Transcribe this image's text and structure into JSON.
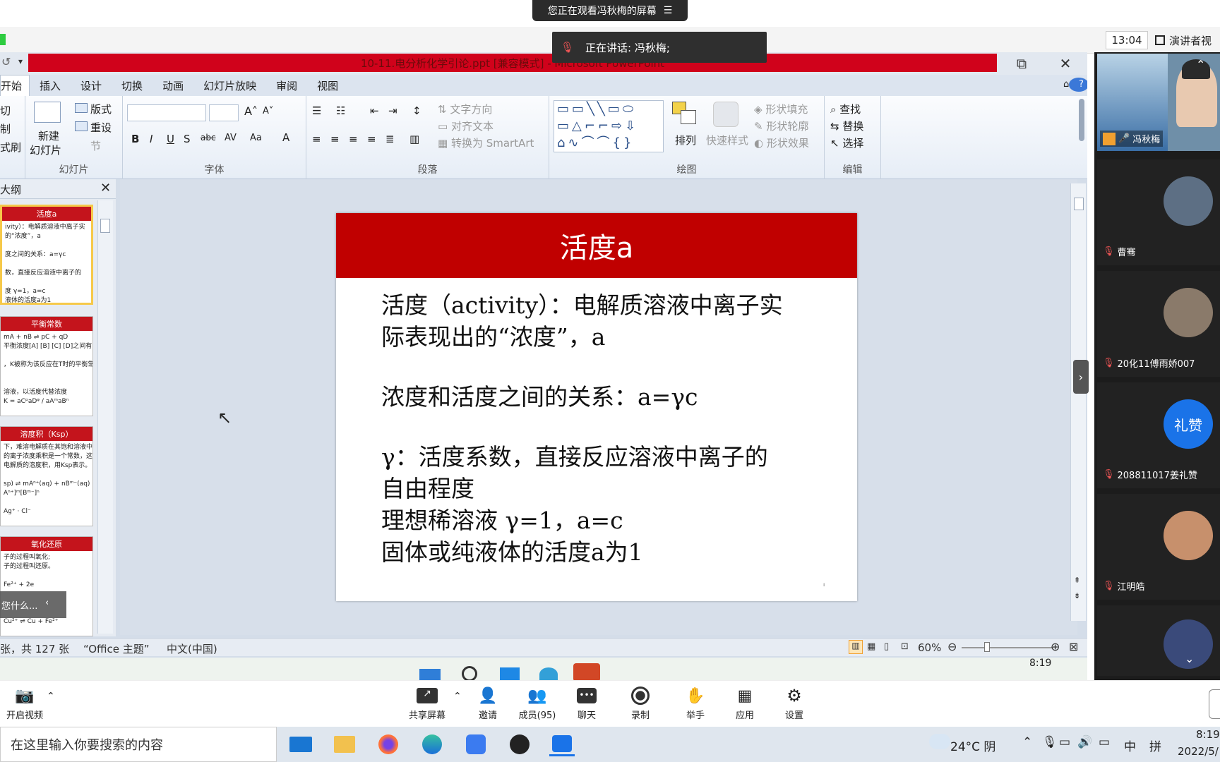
{
  "meeting": {
    "share_banner": "您正在观看冯秋梅的屏幕",
    "speaking": "正在讲话: 冯秋梅;",
    "clock": "13:04",
    "speaker_view": "演讲者视"
  },
  "ppt": {
    "title": "10-11.电分析化学引论.ppt [兼容模式] - Microsoft PowerPoint",
    "tabs": [
      "开始",
      "插入",
      "设计",
      "切换",
      "动画",
      "幻灯片放映",
      "审阅",
      "视图"
    ],
    "clipboard": {
      "cut": "切",
      "copy": "制",
      "format": "式刷"
    },
    "slides_group": {
      "new": "新建",
      "new2": "幻灯片",
      "layout": "版式",
      "reset": "重设",
      "section": "节",
      "label": "幻灯片"
    },
    "font_group": {
      "label": "字体"
    },
    "para_group": {
      "text_dir": "文字方向",
      "align_text": "对齐文本",
      "smartart": "转换为 SmartArt",
      "label": "段落"
    },
    "draw_group": {
      "arrange": "排列",
      "quick_styles": "快速样式",
      "fill": "形状填充",
      "outline": "形状轮廓",
      "effects": "形状效果",
      "label": "绘图"
    },
    "edit_group": {
      "find": "查找",
      "replace": "替换",
      "select": "选择",
      "label": "编辑"
    },
    "outline_tab": "大纲",
    "thumbs": [
      {
        "title": "活度a",
        "lines": [
          "ivity）：电解质溶液中离子实",
          "的“浓度”，a",
          "",
          "度之间的关系：a=γc",
          "",
          "数，直接反应溶液中离子的",
          "",
          "度 γ=1，a=c",
          "液体的活度a为1"
        ]
      },
      {
        "title": "平衡常数",
        "lines": [
          "mA + nB ⇌ pC + qD",
          "平衡浓度[A] [B] [C] [D]之间有",
          "",
          "，K被称为该反应在T时的平衡常",
          "",
          "",
          "溶液，以活度代替浓度",
          "K = aCᵖaDᵠ / aAᵐaBⁿ"
        ]
      },
      {
        "title": "溶度积（Ksp）",
        "lines": [
          "下，难溶电解质在其饱和溶液中",
          "的离子浓度乘积是一个常数，这个常数就",
          "电解质的溶度积，用Ksp表示。",
          "",
          "sp) ⇌ mAⁿ⁺(aq) + nBᵐ⁻(aq)",
          "Aⁿ⁺]ᵐ[Bᵐ⁻]ⁿ",
          "",
          "Ag⁺ · Cl⁻"
        ]
      },
      {
        "title": "氧化还原",
        "lines": [
          "子的过程叫氧化;",
          "子的过程叫还原。",
          "",
          "Fe²⁺ + 2e",
          "",
          "",
          "",
          "Cu²⁺ ⇌ Cu + Fe²⁺"
        ]
      }
    ],
    "thumb_overlay": "您什么...",
    "slide": {
      "title": "活度a",
      "lines": [
        "活度（activity）：电解质溶液中离子实",
        "际表现出的“浓度”，a",
        "",
        "浓度和活度之间的关系：a=γc",
        "",
        "γ：活度系数，直接反应溶液中离子的",
        "自由程度",
        "理想稀溶液 γ=1，a=c",
        "固体或纯液体的活度a为1"
      ]
    },
    "status": {
      "slide_count": "张，共 127 张",
      "theme": "“Office 主题”",
      "lang": "中文(中国)",
      "zoom": "60%"
    },
    "taskbar_time": "8:19"
  },
  "participants": [
    {
      "name": "冯秋梅",
      "avatar_text": "",
      "color": "#4a8de0"
    },
    {
      "name": "曹骞",
      "avatar_text": "",
      "color": "#6c7a8a"
    },
    {
      "name": "20化11傅雨娇007",
      "avatar_text": "",
      "color": "#8a7060"
    },
    {
      "name": "208811017姜礼赞",
      "avatar_text": "礼赞",
      "color": "#1a73e8"
    },
    {
      "name": "江明皓",
      "avatar_text": "",
      "color": "#c08a6a"
    }
  ],
  "toolbar": {
    "video": "开启视频",
    "share": "共享屏幕",
    "invite": "邀请",
    "members": "成员(95)",
    "chat": "聊天",
    "record": "录制",
    "raise": "举手",
    "apps": "应用",
    "settings": "设置"
  },
  "windows": {
    "search_placeholder": "在这里输入你要搜索的内容",
    "weather": "24°C 阴",
    "ime": "中",
    "ime2": "拼",
    "time": "8:19",
    "date": "2022/5/"
  }
}
